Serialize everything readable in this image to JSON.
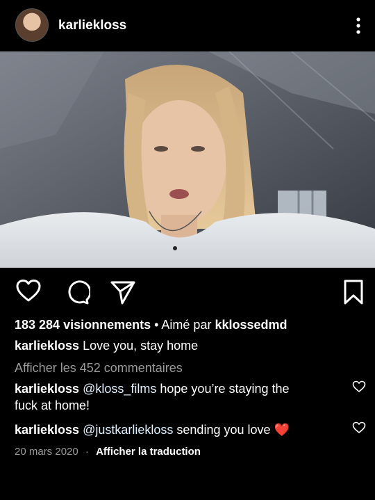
{
  "post": {
    "username": "karliekloss",
    "views": "183 284 visionnements",
    "liked_by_prefix": " • Aimé par ",
    "liked_by_user": "kklossedmd",
    "caption_user": "karliekloss",
    "caption_text": " Love you, stay home",
    "view_comments": "Afficher les 452 commentaires",
    "comments": [
      {
        "user": "karliekloss",
        "mention": "@kloss_films",
        "text_line1": " hope you’re staying the",
        "text_line2": "fuck at home!"
      },
      {
        "user": "karliekloss",
        "mention": "@justkarliekloss",
        "text": " sending you love ",
        "emoji": "❤️"
      }
    ],
    "date": "20 mars 2020",
    "separator": "·",
    "translate": "Afficher la traduction"
  },
  "icons": {
    "more": "more-vertical-icon",
    "like": "heart-icon",
    "comment": "comment-icon",
    "share": "send-icon",
    "save": "bookmark-icon",
    "sound": "speaker-icon"
  },
  "colors": {
    "background": "#000000",
    "text": "#ffffff",
    "muted": "#9a9a9a",
    "mention": "#e0f1ff",
    "heart_emoji": "#e0245e"
  }
}
